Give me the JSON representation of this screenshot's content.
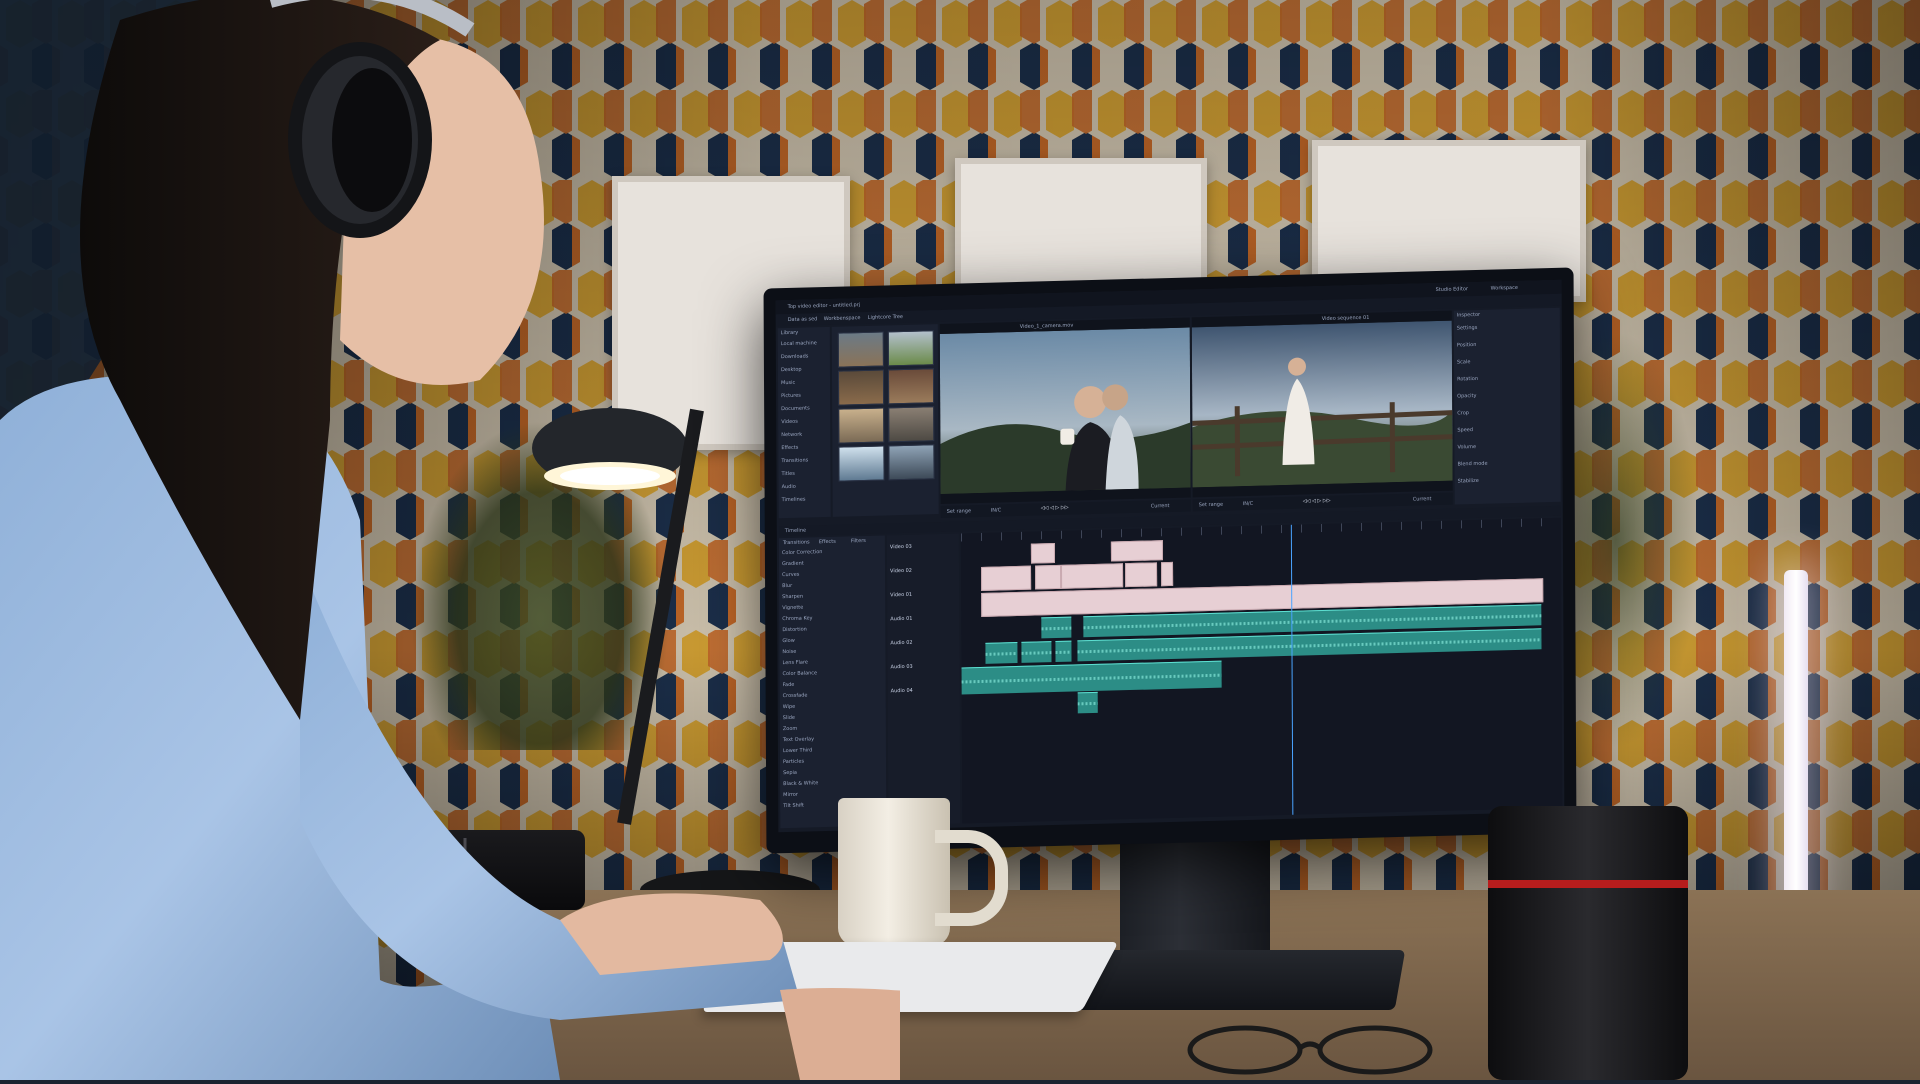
{
  "scene": {
    "description_tags": [
      "video-editing-workstation"
    ],
    "colors": {
      "wall_yellow": "#e9b23a",
      "wall_orange": "#d9742c",
      "wall_navy": "#1f3554",
      "wall_cream": "#e9dcc4",
      "clip_pink": "#e7cfd4",
      "clip_aqua": "#2c8d86",
      "shirt_blue": "#a9c4e6"
    }
  },
  "editor": {
    "window_title": "Top video editor - untitled.prj",
    "tabs": [
      "Data as sed",
      "Workbenspace",
      "Lightcore Tree"
    ],
    "library_header": "Library",
    "library_items": [
      "Local machine",
      "Downloads",
      "Desktop",
      "Music",
      "Pictures",
      "Documents",
      "Videos",
      "Network",
      "Effects",
      "Transitions",
      "Titles",
      "Audio",
      "Timelines"
    ],
    "viewer_left_title": "Video_1_camera.mov",
    "viewer_right_title": "Video sequence 01",
    "left_controls": {
      "set_range": "Set range",
      "marker": "IN/C",
      "current": "Current"
    },
    "right_controls": {
      "set_range": "Set range",
      "marker": "IN/C",
      "current": "Current"
    },
    "inspector_title": "Inspector",
    "inspector_items": [
      "Settings",
      "Position",
      "Scale",
      "Rotation",
      "Opacity",
      "Crop",
      "Speed",
      "Volume",
      "Blend mode",
      "Stabilize"
    ],
    "timeline_header": "Timeline",
    "effects_tabs": [
      "Transitions",
      "Effects",
      "Filters"
    ],
    "effects_list": [
      "Color Correction",
      "Gradient",
      "Curves",
      "Blur",
      "Sharpen",
      "Vignette",
      "Chroma Key",
      "Distortion",
      "Glow",
      "Noise",
      "Lens Flare",
      "Color Balance",
      "Fade",
      "Crossfade",
      "Wipe",
      "Slide",
      "Zoom",
      "Text Overlay",
      "Lower Third",
      "Particles",
      "Sepia",
      "Black & White",
      "Mirror",
      "Tilt Shift"
    ],
    "tracks": [
      {
        "label": "Video 03",
        "type": "video"
      },
      {
        "label": "Video 02",
        "type": "video"
      },
      {
        "label": "Video 01",
        "type": "video"
      },
      {
        "label": "Audio 01",
        "type": "audio"
      },
      {
        "label": "Audio 02",
        "type": "audio"
      },
      {
        "label": "Audio 03",
        "type": "audio"
      },
      {
        "label": "Audio 04",
        "type": "audio"
      }
    ],
    "header_right": [
      "Studio Editor",
      "Workspace"
    ]
  }
}
